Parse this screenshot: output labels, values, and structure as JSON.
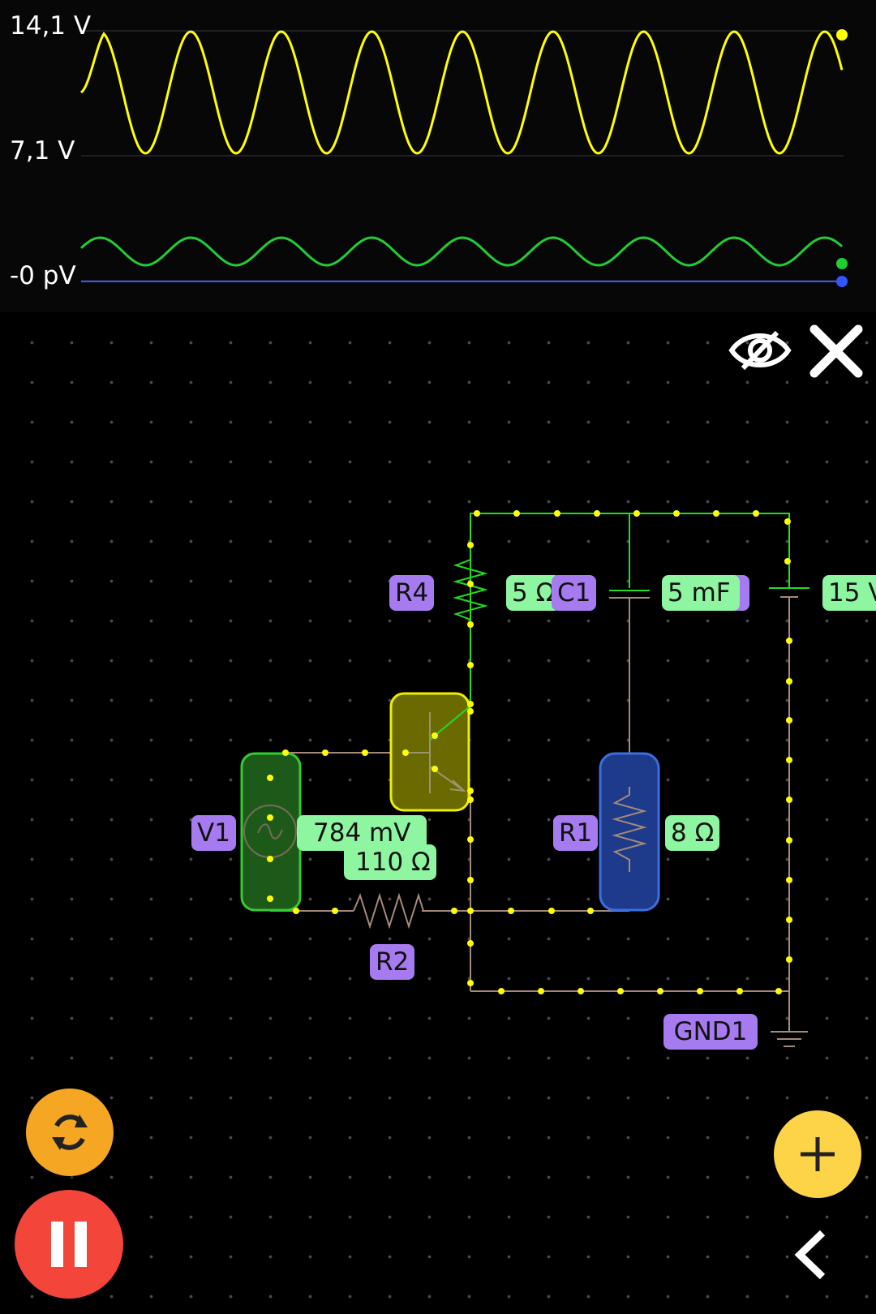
{
  "scope": {
    "labels": {
      "top": "14,1 V",
      "mid": "7,1 V",
      "bottom": "-0 pV"
    },
    "traces": [
      {
        "color": "#ffff00",
        "cycles": 8.4,
        "role": "large sine"
      },
      {
        "color": "#22cc33",
        "cycles": 8.4,
        "role": "small sine"
      },
      {
        "color": "#3355ff",
        "cycles": 0,
        "role": "flat"
      }
    ]
  },
  "toolbar": {
    "visibility_icon": "eye-off-icon",
    "close_icon": "close-icon"
  },
  "components": {
    "R4": {
      "name": "R4",
      "value": "5 Ω"
    },
    "C1": {
      "name": "C1",
      "value": "5 mF"
    },
    "V2": {
      "name": "V",
      "value": "15 V"
    },
    "V1": {
      "name": "V1",
      "value": "784 mV",
      "value2": "110 Ω"
    },
    "R1": {
      "name": "R1",
      "value": "8 Ω"
    },
    "R2": {
      "name": "R2"
    },
    "GND1": {
      "name": "GND1"
    }
  },
  "colors": {
    "wire_active": "#22dd22",
    "wire_idle": "#a58a7a",
    "node": "#ffff00",
    "tag_name": "#a77bf0",
    "tag_value": "#8ef5a0",
    "transistor": "#6b6a00",
    "source": "#1d5a1a",
    "resistor_r1": "#1e3a8a"
  },
  "buttons": {
    "refresh_icon": "refresh-icon",
    "pause_icon": "pause-icon",
    "add_icon": "plus-icon",
    "back_icon": "chevron-left-icon"
  }
}
